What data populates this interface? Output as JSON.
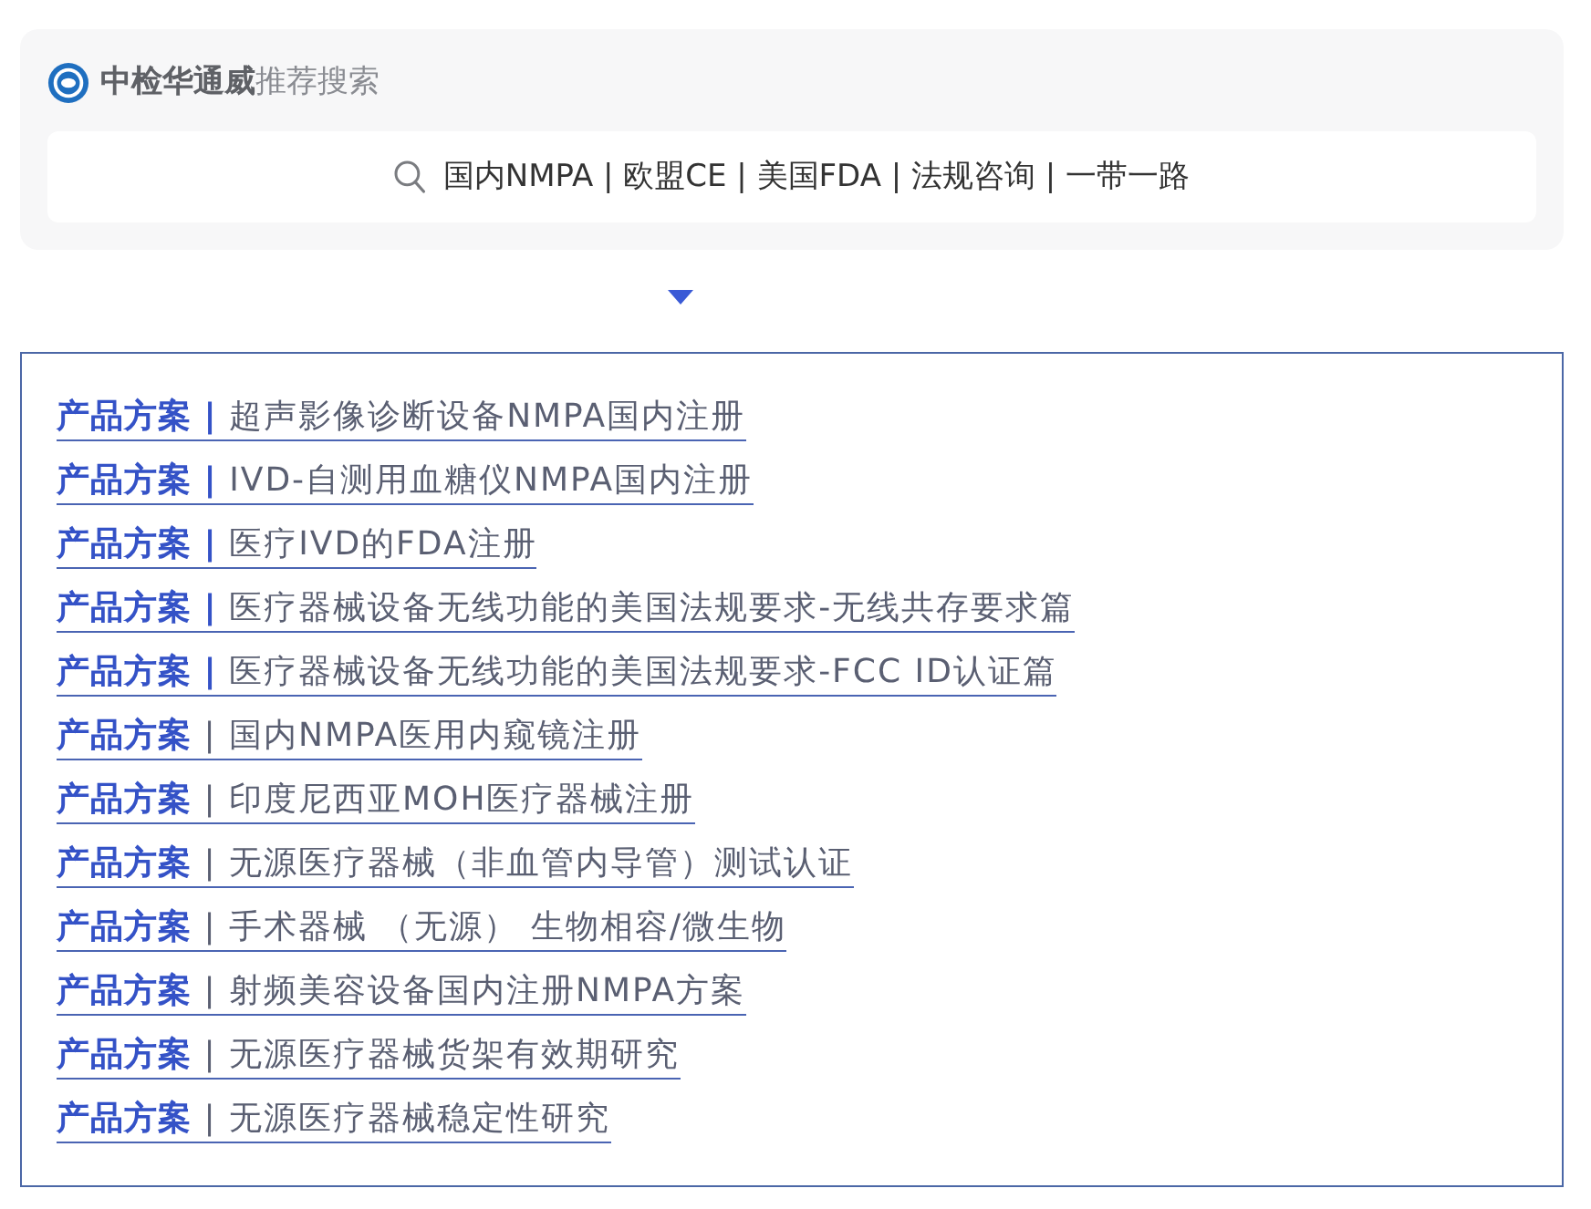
{
  "header": {
    "title": "**中检华通威**推荐搜索"
  },
  "search": {
    "value": "国内NMPA | 欧盟CE | 美国FDA | 法规咨询 | 一带一路"
  },
  "links": [
    {
      "text": "**产品方案 |** 超声影像诊断设备NMPA国内注册"
    },
    {
      "text": "**产品方案 |** IVD-自测用血糖仪NMPA国内注册"
    },
    {
      "text": "**产品方案 |** 医疗IVD的FDA注册"
    },
    {
      "text": "**产品方案 |** 医疗器械设备无线功能的美国法规要求-无线共存要求篇"
    },
    {
      "text": "**产品方案 |** 医疗器械设备无线功能的美国法规要求-FCC ID认证篇"
    },
    {
      "text": "**产品方案** | 国内NMPA医用内窥镜注册"
    },
    {
      "text": "**产品方案** | 印度尼西亚MOH医疗器械注册"
    },
    {
      "text": "**产品方案** | 无源医疗器械（非血管内导管）测试认证"
    },
    {
      "text": "**产品方案** | 手术器械 （无源） 生物相容/微生物"
    },
    {
      "text": "**产品方案** | 射频美容设备国内注册NMPA方案"
    },
    {
      "text": "**产品方案** | 无源医疗器械货架有效期研究"
    },
    {
      "text": "**产品方案** | 无源医疗器械稳定性研究"
    }
  ]
}
